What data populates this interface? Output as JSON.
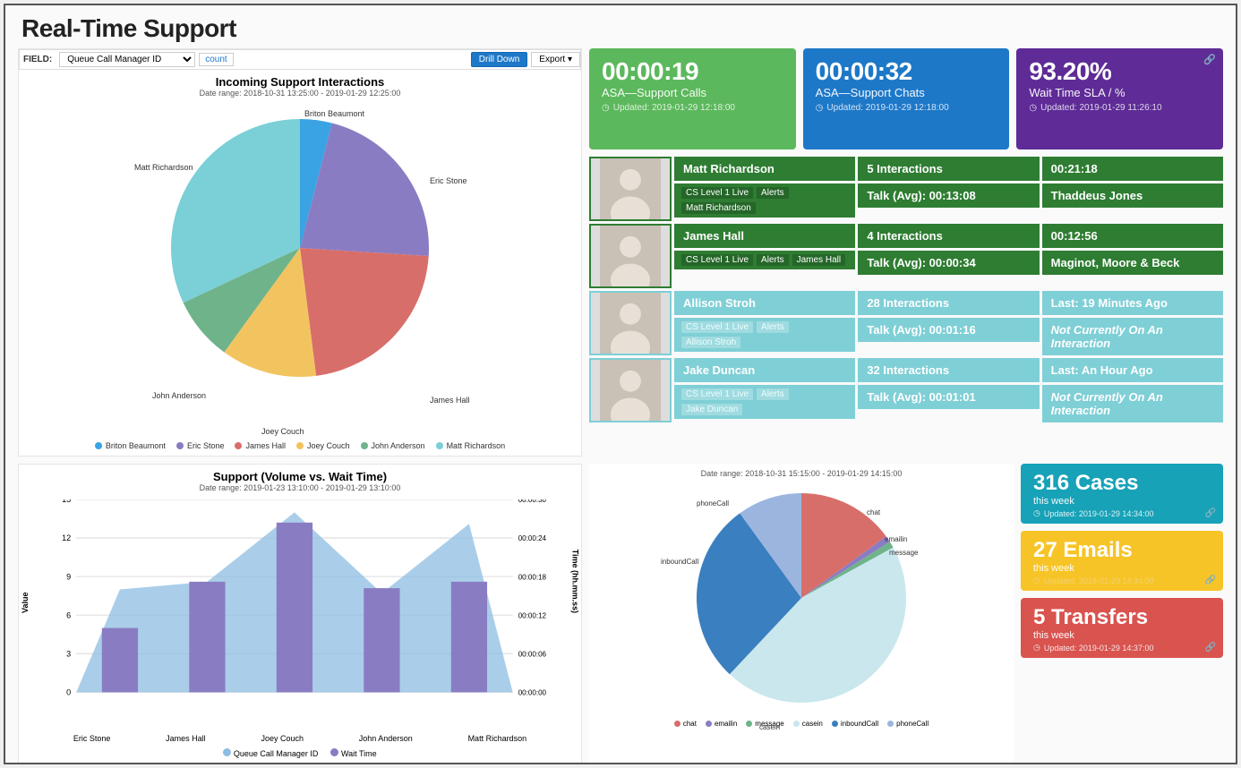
{
  "title": "Real-Time Support",
  "toolbar": {
    "field_label": "FIELD:",
    "field_select": "Queue Call Manager ID",
    "count": "count",
    "drill": "Drill Down",
    "export": "Export"
  },
  "kpis": [
    {
      "value": "00:00:19",
      "label": "ASA—Support Calls",
      "updated": "Updated: 2019-01-29 12:18:00",
      "cls": "kpi-green"
    },
    {
      "value": "00:00:32",
      "label": "ASA—Support Chats",
      "updated": "Updated: 2019-01-29 12:18:00",
      "cls": "kpi-blue"
    },
    {
      "value": "93.20%",
      "label": "Wait Time SLA / %",
      "updated": "Updated: 2019-01-29 11:26:10",
      "cls": "kpi-purple",
      "link": true
    }
  ],
  "agents": [
    {
      "style": "row-dkgreen",
      "name": "Matt Richardson",
      "tags": [
        "CS Level 1 Live",
        "Alerts",
        "Matt Richardson"
      ],
      "stat1": "5 Interactions",
      "stat2": "Talk (Avg): 00:13:08",
      "time": "00:21:18",
      "extra": "Thaddeus Jones"
    },
    {
      "style": "row-dkgreen",
      "name": "James Hall",
      "tags": [
        "CS Level 1 Live",
        "Alerts",
        "James Hall"
      ],
      "stat1": "4 Interactions",
      "stat2": "Talk (Avg): 00:00:34",
      "time": "00:12:56",
      "extra": "Maginot, Moore & Beck"
    },
    {
      "style": "row-teal",
      "name": "Allison Stroh",
      "tags": [
        "CS Level 1 Live",
        "Alerts",
        "Allison Stroh"
      ],
      "stat1": "28 Interactions",
      "stat2": "Talk (Avg): 00:01:16",
      "time": "Last: 19 Minutes Ago",
      "extra": "Not Currently On An Interaction",
      "extra_italic": true
    },
    {
      "style": "row-teal",
      "name": "Jake Duncan",
      "tags": [
        "CS Level 1 Live",
        "Alerts",
        "Jake Duncan"
      ],
      "stat1": "32 Interactions",
      "stat2": "Talk (Avg): 00:01:01",
      "time": "Last: An Hour Ago",
      "extra": "Not Currently On An Interaction",
      "extra_italic": true
    }
  ],
  "stats": [
    {
      "value": "316 Cases",
      "label": "this week",
      "updated": "Updated: 2019-01-29 14:34:00",
      "cls": "sc-teal"
    },
    {
      "value": "27 Emails",
      "label": "this week",
      "updated": "Updated: 2019-01-29 14:34:00",
      "cls": "sc-yellow"
    },
    {
      "value": "5 Transfers",
      "label": "this week",
      "updated": "Updated: 2019-01-29 14:37:00",
      "cls": "sc-red"
    }
  ],
  "chart_data": [
    {
      "type": "pie",
      "title": "Incoming Support Interactions",
      "subtitle": "Date range: 2018-10-31 13:25:00 - 2019-01-29 12:25:00",
      "categories": [
        "Briton Beaumont",
        "Eric Stone",
        "James Hall",
        "Joey Couch",
        "John Anderson",
        "Matt Richardson"
      ],
      "values": [
        4,
        22,
        22,
        12,
        8,
        32
      ],
      "colors": [
        "#3aa3e3",
        "#8a7cc3",
        "#d86e6a",
        "#f2c45f",
        "#6fb38a",
        "#7bcfd6"
      ]
    },
    {
      "type": "bar",
      "title": "Support (Volume vs. Wait Time)",
      "subtitle": "Date range: 2019-01-23 13:10:00 - 2019-01-29 13:10:00",
      "categories": [
        "Eric Stone",
        "James Hall",
        "Joey Couch",
        "John Anderson",
        "Matt Richardson"
      ],
      "series": [
        {
          "name": "Queue Call Manager ID",
          "type": "area",
          "color": "#8dbde2",
          "values": [
            8,
            8.6,
            14,
            7.7,
            13.1
          ]
        },
        {
          "name": "Wait Time",
          "type": "bar",
          "color": "#8a7cc3",
          "values": [
            5,
            8.6,
            13.2,
            8.1,
            8.6
          ]
        }
      ],
      "ylabel": "Value",
      "ylim": [
        0,
        15
      ],
      "y2label": "Time (hh.mm.ss)",
      "y2ticks": [
        "00:00:00",
        "00:00:06",
        "00:00:12",
        "00:00:18",
        "00:00:24",
        "00:00:30"
      ]
    },
    {
      "type": "pie",
      "subtitle": "Date range: 2018-10-31 15:15:00 - 2019-01-29 14:15:00",
      "categories": [
        "chat",
        "emailin",
        "message",
        "casein",
        "inboundCall",
        "phoneCall"
      ],
      "values": [
        15,
        1,
        1,
        45,
        28,
        10
      ],
      "colors": [
        "#d86e6a",
        "#8a7cc3",
        "#6fb38a",
        "#c9e7ec",
        "#3a7fbf",
        "#9bb5df"
      ]
    }
  ]
}
